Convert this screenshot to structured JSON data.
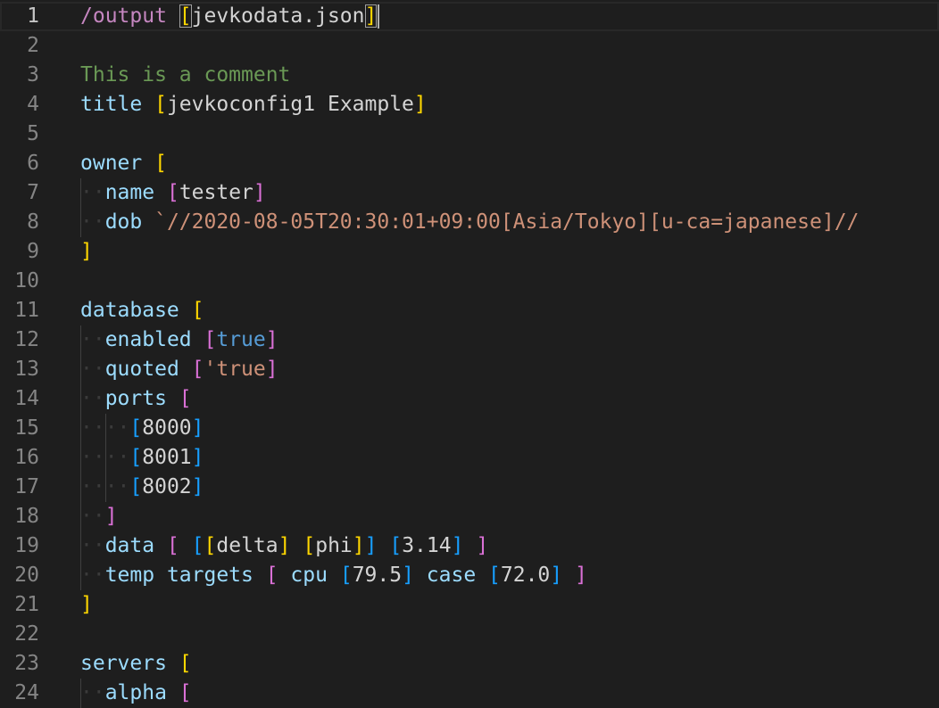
{
  "colors": {
    "background": "#1e1e1e",
    "line_number": "#858585",
    "line_number_active": "#c6c6c6",
    "key": "#9cdcfe",
    "string": "#ce9178",
    "comment": "#6a9955",
    "bracket_gold": "#ffd700",
    "bracket_magenta": "#da70d6",
    "bracket_blue": "#179fff",
    "keyword_true": "#569cd6",
    "directive": "#c586c0",
    "number": "#b5cea8",
    "plain": "#d4d4d4",
    "indent_dot": "#3b3b3b"
  },
  "editor": {
    "active_line": 1,
    "lines": [
      {
        "n": "1",
        "indent": 0,
        "tokens": [
          [
            "/output ",
            "directive"
          ],
          [
            "[",
            "bracket_gold",
            "bm"
          ],
          [
            "jevkodata.json",
            "plain"
          ],
          [
            "]",
            "bracket_gold",
            "bm"
          ],
          [
            "",
            "cursor"
          ]
        ]
      },
      {
        "n": "2",
        "indent": 0,
        "tokens": []
      },
      {
        "n": "3",
        "indent": 0,
        "tokens": [
          [
            "This is a comment",
            "comment"
          ]
        ]
      },
      {
        "n": "4",
        "indent": 0,
        "tokens": [
          [
            "title ",
            "key"
          ],
          [
            "[",
            "bracket_gold"
          ],
          [
            "jevkoconfig1 Example",
            "plain"
          ],
          [
            "]",
            "bracket_gold"
          ]
        ]
      },
      {
        "n": "5",
        "indent": 0,
        "tokens": []
      },
      {
        "n": "6",
        "indent": 0,
        "tokens": [
          [
            "owner ",
            "key"
          ],
          [
            "[",
            "bracket_gold"
          ]
        ]
      },
      {
        "n": "7",
        "indent": 1,
        "tokens": [
          [
            "name ",
            "key"
          ],
          [
            "[",
            "bracket_magenta"
          ],
          [
            "tester",
            "plain"
          ],
          [
            "]",
            "bracket_magenta"
          ]
        ]
      },
      {
        "n": "8",
        "indent": 1,
        "tokens": [
          [
            "dob ",
            "key"
          ],
          [
            "`//2020-08-05T20:30:01+09:00[Asia/Tokyo][u-ca=japanese]//",
            "string"
          ]
        ]
      },
      {
        "n": "9",
        "indent": 0,
        "tokens": [
          [
            "]",
            "bracket_gold"
          ]
        ]
      },
      {
        "n": "10",
        "indent": 0,
        "tokens": []
      },
      {
        "n": "11",
        "indent": 0,
        "tokens": [
          [
            "database ",
            "key"
          ],
          [
            "[",
            "bracket_gold"
          ]
        ]
      },
      {
        "n": "12",
        "indent": 1,
        "tokens": [
          [
            "enabled ",
            "key"
          ],
          [
            "[",
            "bracket_magenta"
          ],
          [
            "true",
            "keyword_true"
          ],
          [
            "]",
            "bracket_magenta"
          ]
        ]
      },
      {
        "n": "13",
        "indent": 1,
        "tokens": [
          [
            "quoted ",
            "key"
          ],
          [
            "[",
            "bracket_magenta"
          ],
          [
            "'true",
            "string"
          ],
          [
            "]",
            "bracket_magenta"
          ]
        ]
      },
      {
        "n": "14",
        "indent": 1,
        "tokens": [
          [
            "ports ",
            "key"
          ],
          [
            "[",
            "bracket_magenta"
          ]
        ]
      },
      {
        "n": "15",
        "indent": 2,
        "tokens": [
          [
            "[",
            "bracket_blue"
          ],
          [
            "8000",
            "plain"
          ],
          [
            "]",
            "bracket_blue"
          ]
        ]
      },
      {
        "n": "16",
        "indent": 2,
        "tokens": [
          [
            "[",
            "bracket_blue"
          ],
          [
            "8001",
            "plain"
          ],
          [
            "]",
            "bracket_blue"
          ]
        ]
      },
      {
        "n": "17",
        "indent": 2,
        "tokens": [
          [
            "[",
            "bracket_blue"
          ],
          [
            "8002",
            "plain"
          ],
          [
            "]",
            "bracket_blue"
          ]
        ]
      },
      {
        "n": "18",
        "indent": 1,
        "tokens": [
          [
            "]",
            "bracket_magenta"
          ]
        ]
      },
      {
        "n": "19",
        "indent": 1,
        "tokens": [
          [
            "data ",
            "key"
          ],
          [
            "[",
            "bracket_magenta"
          ],
          [
            " ",
            "plain"
          ],
          [
            "[",
            "bracket_blue"
          ],
          [
            "[",
            "bracket_gold"
          ],
          [
            "delta",
            "plain"
          ],
          [
            "]",
            "bracket_gold"
          ],
          [
            " ",
            "plain"
          ],
          [
            "[",
            "bracket_gold"
          ],
          [
            "phi",
            "plain"
          ],
          [
            "]",
            "bracket_gold"
          ],
          [
            "]",
            "bracket_blue"
          ],
          [
            " ",
            "plain"
          ],
          [
            "[",
            "bracket_blue"
          ],
          [
            "3.14",
            "plain"
          ],
          [
            "]",
            "bracket_blue"
          ],
          [
            " ",
            "plain"
          ],
          [
            "]",
            "bracket_magenta"
          ]
        ]
      },
      {
        "n": "20",
        "indent": 1,
        "tokens": [
          [
            "temp targets ",
            "key"
          ],
          [
            "[",
            "bracket_magenta"
          ],
          [
            " cpu ",
            "key"
          ],
          [
            "[",
            "bracket_blue"
          ],
          [
            "79.5",
            "plain"
          ],
          [
            "]",
            "bracket_blue"
          ],
          [
            " case ",
            "key"
          ],
          [
            "[",
            "bracket_blue"
          ],
          [
            "72.0",
            "plain"
          ],
          [
            "]",
            "bracket_blue"
          ],
          [
            " ",
            "plain"
          ],
          [
            "]",
            "bracket_magenta"
          ]
        ]
      },
      {
        "n": "21",
        "indent": 0,
        "tokens": [
          [
            "]",
            "bracket_gold"
          ]
        ]
      },
      {
        "n": "22",
        "indent": 0,
        "tokens": []
      },
      {
        "n": "23",
        "indent": 0,
        "tokens": [
          [
            "servers ",
            "key"
          ],
          [
            "[",
            "bracket_gold"
          ]
        ]
      },
      {
        "n": "24",
        "indent": 1,
        "tokens": [
          [
            "alpha ",
            "key"
          ],
          [
            "[",
            "bracket_magenta"
          ]
        ]
      }
    ]
  }
}
